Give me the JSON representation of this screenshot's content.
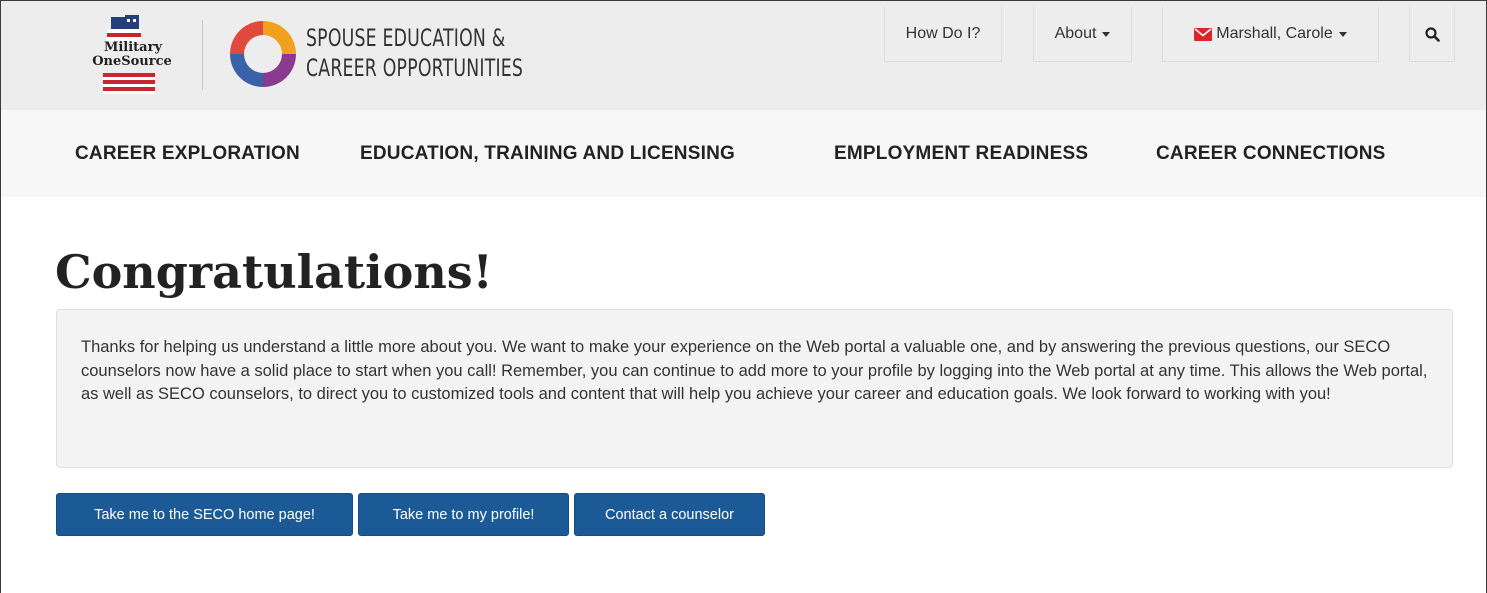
{
  "header": {
    "mos_logo": {
      "line1": "Military",
      "line2": "OneSource"
    },
    "seco_logo": {
      "line1": "SPOUSE EDUCATION &",
      "line2": "CAREER OPPORTUNITIES"
    },
    "how_do_i": "How Do I?",
    "about": "About",
    "user_name": "Marshall, Carole",
    "icons": {
      "mail": "envelope-icon",
      "search": "search-icon",
      "caret": "caret-down-icon"
    },
    "accent_color": "#d9262c"
  },
  "nav": {
    "items": [
      {
        "label": "CAREER EXPLORATION"
      },
      {
        "label": "EDUCATION, TRAINING AND LICENSING"
      },
      {
        "label": "EMPLOYMENT READINESS"
      },
      {
        "label": "CAREER CONNECTIONS"
      }
    ]
  },
  "main": {
    "title": "Congratulations!",
    "message": "Thanks for helping us understand a little more about you. We want to make your experience on the Web portal a valuable one, and by answering the previous questions, our SECO counselors now have a solid place to start when you call! Remember, you can continue to add more to your profile by logging into the Web portal at any time. This allows the Web portal, as well as SECO counselors, to direct you to customized tools and content that will help you achieve your career and education goals. We look forward to working with you!",
    "buttons": {
      "home": "Take me to the SECO home page!",
      "profile": "Take me to my profile!",
      "counselor": "Contact a counselor"
    },
    "button_color": "#1b5a96"
  }
}
